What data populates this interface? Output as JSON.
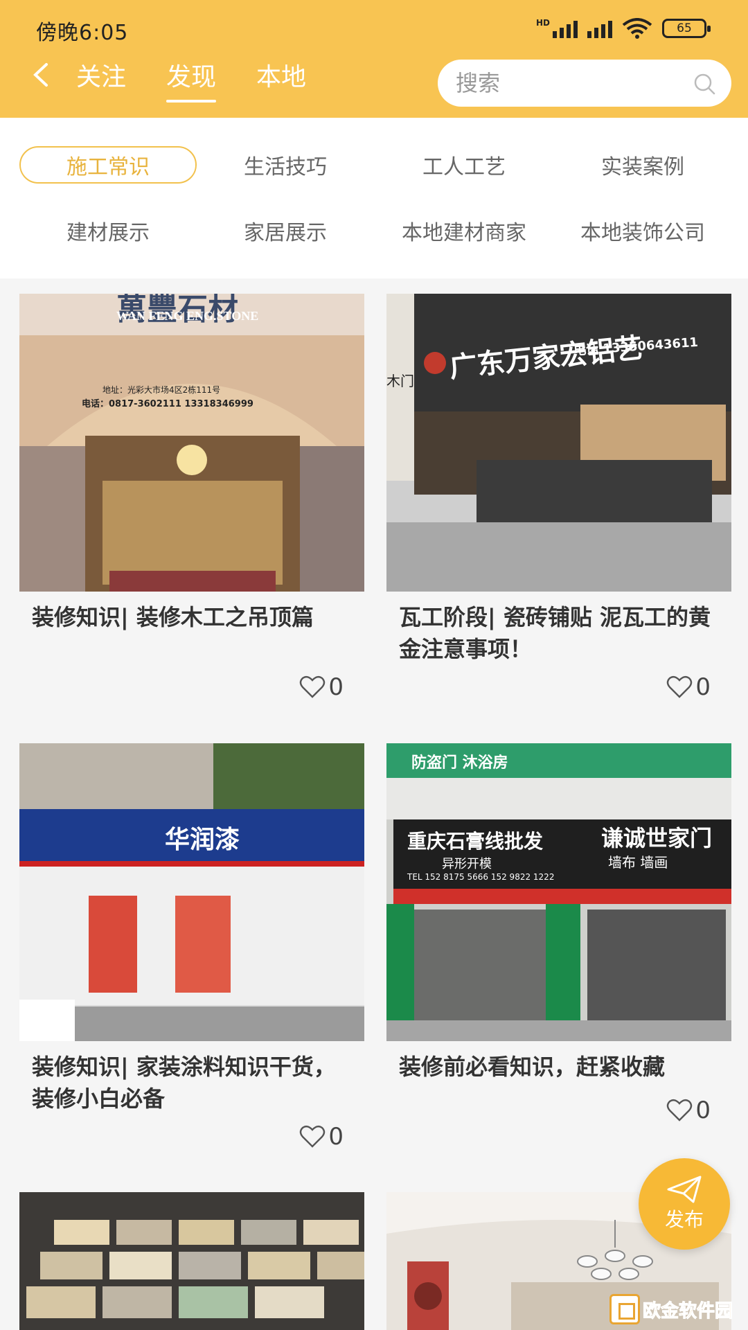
{
  "status": {
    "time": "傍晚6:05",
    "network": "HD",
    "battery": "65"
  },
  "header": {
    "tabs": [
      {
        "label": "关注",
        "active": false
      },
      {
        "label": "发现",
        "active": true
      },
      {
        "label": "本地",
        "active": false
      }
    ],
    "search": {
      "placeholder": "搜索"
    }
  },
  "categories": [
    {
      "label": "施工常识",
      "active": true
    },
    {
      "label": "生活技巧"
    },
    {
      "label": "工人工艺"
    },
    {
      "label": "实装案例"
    },
    {
      "label": "建材展示"
    },
    {
      "label": "家居展示"
    },
    {
      "label": "本地建材商家"
    },
    {
      "label": "本地装饰公司"
    }
  ],
  "cards": [
    {
      "title": "装修知识| 装修木工之吊顶篇",
      "likes": "0",
      "image": {
        "sign_main": "萬豐石材",
        "sign_sub": "WAN FENG ENG.STONE",
        "sign_addr": "地址：光彩大市场4区2栋111号",
        "sign_tel": "电话：0817-3602111  13318346999"
      }
    },
    {
      "title": "瓦工阶段| 瓷砖铺贴 泥瓦工的黄金注意事项！",
      "likes": "0",
      "image": {
        "sign_main": "广东万家宏铝艺",
        "sign_tel": "电话 13350643611",
        "sign_side": "木门"
      }
    },
    {
      "title": "装修知识| 家装涂料知识干货，装修小白必备",
      "likes": "0",
      "image": {
        "sign_main": "华润漆"
      }
    },
    {
      "title": "装修前必看知识，赶紧收藏",
      "likes": "0",
      "image": {
        "sign_top": "防盗门 沐浴房",
        "sign_main": "重庆石膏线批发",
        "sign_main2": "谦诚世家门",
        "sign_sub": "异形开模",
        "sign_tel": "TEL 152 8175 5666   152 9822 1222",
        "sign_right_sub": "墙布 墙画"
      }
    },
    {
      "title": "",
      "likes": ""
    },
    {
      "title": "",
      "likes": ""
    }
  ],
  "fab": {
    "label": "发布"
  },
  "watermark": {
    "text": "欧金软件园"
  },
  "colors": {
    "header": "#f8c452",
    "accent": "#e8b33d",
    "fab": "#f7b936"
  }
}
